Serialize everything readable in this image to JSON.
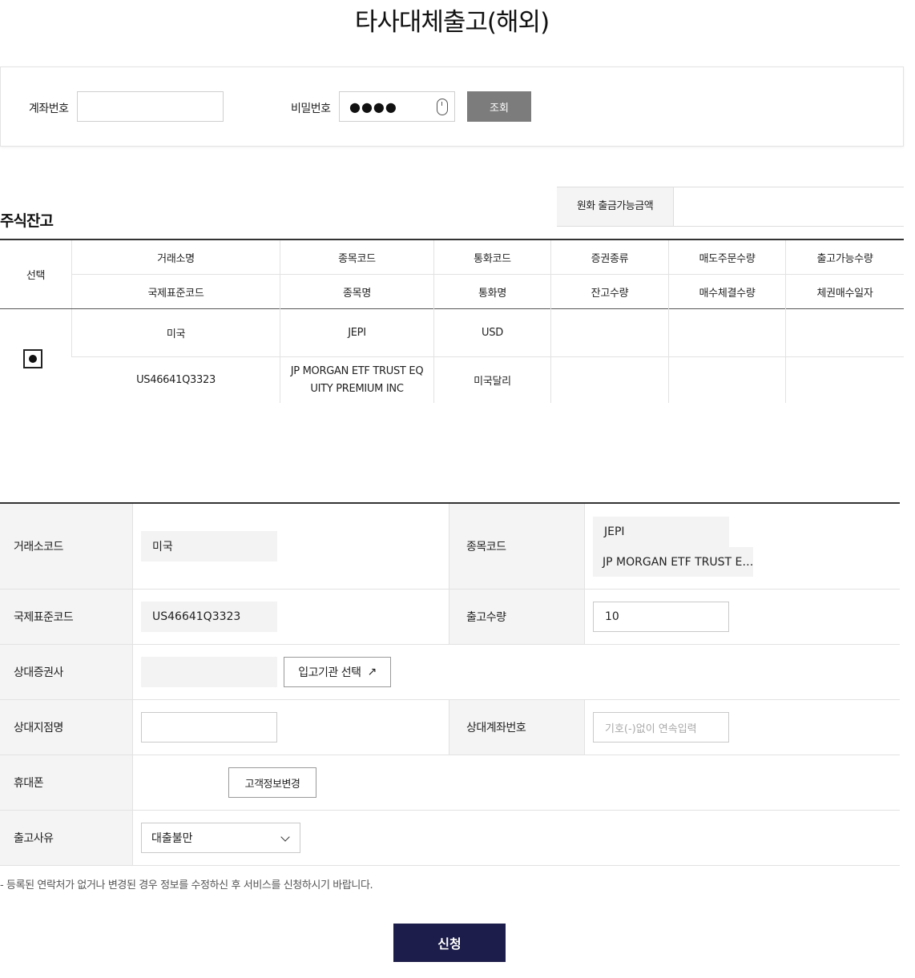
{
  "title": "타사대체출고(해외)",
  "search": {
    "account_label": "계좌번호",
    "account_value": "",
    "password_label": "비밀번호",
    "password_dots": "●●●●",
    "search_button": "조회"
  },
  "stock": {
    "section_title": "주식잔고",
    "krw_label": "원화 출금가능금액",
    "krw_value": "",
    "header_select": "선택",
    "header_row1": [
      "거래소명",
      "종목코드",
      "통화코드",
      "증권종류",
      "매도주문수량",
      "출고가능수량"
    ],
    "header_row2": [
      "국제표준코드",
      "종목명",
      "통화명",
      "잔고수량",
      "매수체결수량",
      "체권매수일자"
    ],
    "rows": [
      {
        "selected": true,
        "row1": [
          "미국",
          "JEPI",
          "USD",
          "",
          "",
          ""
        ],
        "row2": [
          "US46641Q3323",
          "JP MORGAN ETF TRUST EQ\nUITY PREMIUM INC",
          "미국달리",
          "",
          "",
          ""
        ]
      }
    ]
  },
  "form": {
    "exchange_code_label": "거래소코드",
    "exchange_code_value": "미국",
    "stock_code_label": "종목코드",
    "stock_code_value": "JEPI",
    "stock_name_value": "JP MORGAN ETF TRUST E…",
    "isin_label": "국제표준코드",
    "isin_value": "US46641Q3323",
    "quantity_label": "출고수량",
    "quantity_value": "10",
    "broker_label": "상대증권사",
    "broker_value": "",
    "broker_button": "입고기관 선택",
    "branch_label": "상대지점명",
    "branch_value": "",
    "counter_account_label": "상대계좌번호",
    "counter_account_placeholder": "기호(-)없이 연속입력",
    "phone_label": "휴대폰",
    "phone_value": "",
    "customer_info_button": "고객정보변경",
    "reason_label": "출고사유",
    "reason_selected": "대출불만"
  },
  "notice": "- 등록된 연락처가 없거나 변경된 경우 정보를 수정하신 후 서비스를 신청하시기 바랍니다.",
  "submit_button": "신청"
}
